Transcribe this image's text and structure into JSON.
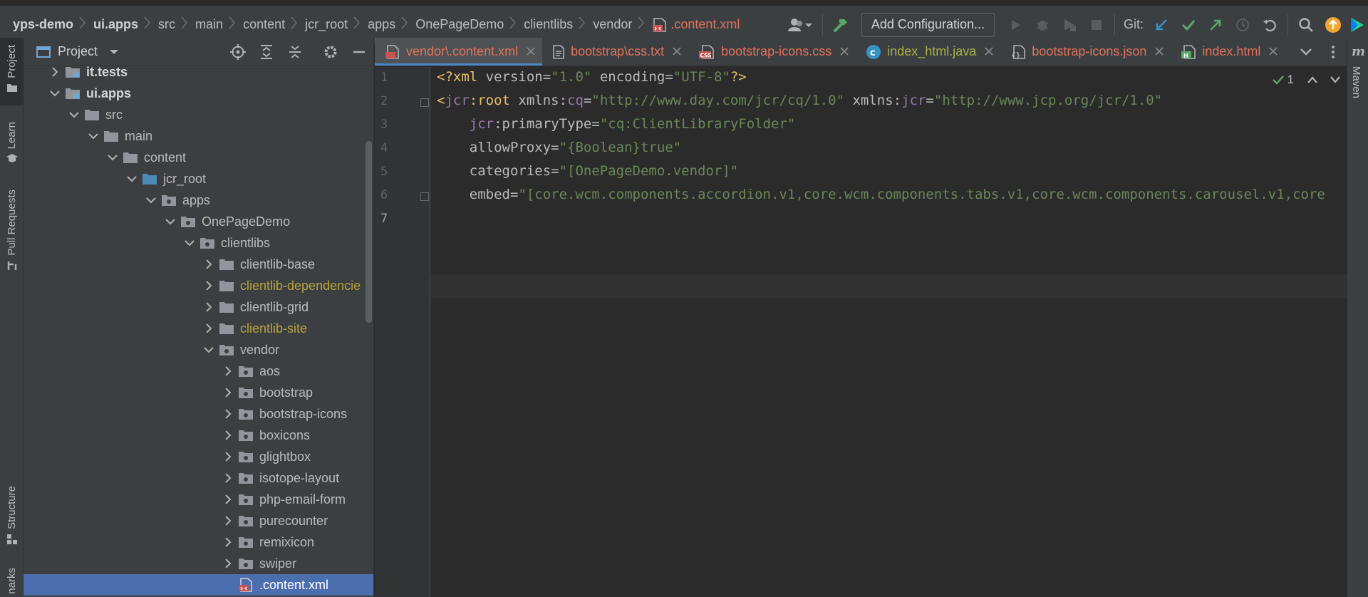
{
  "breadcrumbs": [
    {
      "label": "yps-demo",
      "bold": true
    },
    {
      "label": "ui.apps",
      "bold": true
    },
    {
      "label": "src"
    },
    {
      "label": "main"
    },
    {
      "label": "content"
    },
    {
      "label": "jcr_root"
    },
    {
      "label": "apps"
    },
    {
      "label": "OnePageDemo"
    },
    {
      "label": "clientlibs"
    },
    {
      "label": "vendor"
    },
    {
      "label": ".content.xml",
      "file": true
    }
  ],
  "toolbar": {
    "add_configuration": "Add Configuration...",
    "git_label": "Git:"
  },
  "left_strip": {
    "project": "Project",
    "learn": "Learn",
    "pull_requests": "Pull Requests",
    "structure": "Structure",
    "bookmarks": "narks"
  },
  "right_strip": {
    "maven": "Maven"
  },
  "project_panel": {
    "title": "Project"
  },
  "tree": [
    {
      "label": "it.tests",
      "depth": 0,
      "arrow": "right",
      "icon": "module",
      "bold": true
    },
    {
      "label": "ui.apps",
      "depth": 0,
      "arrow": "down",
      "icon": "module",
      "bold": true
    },
    {
      "label": "src",
      "depth": 1,
      "arrow": "down",
      "icon": "folder"
    },
    {
      "label": "main",
      "depth": 2,
      "arrow": "down",
      "icon": "folder"
    },
    {
      "label": "content",
      "depth": 3,
      "arrow": "down",
      "icon": "folder"
    },
    {
      "label": "jcr_root",
      "depth": 4,
      "arrow": "down",
      "icon": "folder-blue"
    },
    {
      "label": "apps",
      "depth": 5,
      "arrow": "down",
      "icon": "package"
    },
    {
      "label": "OnePageDemo",
      "depth": 6,
      "arrow": "down",
      "icon": "package"
    },
    {
      "label": "clientlibs",
      "depth": 7,
      "arrow": "down",
      "icon": "package"
    },
    {
      "label": "clientlib-base",
      "depth": 8,
      "arrow": "right",
      "icon": "folder"
    },
    {
      "label": "clientlib-dependencie",
      "depth": 8,
      "arrow": "right",
      "icon": "folder",
      "color": "yellow"
    },
    {
      "label": "clientlib-grid",
      "depth": 8,
      "arrow": "right",
      "icon": "folder"
    },
    {
      "label": "clientlib-site",
      "depth": 8,
      "arrow": "right",
      "icon": "folder",
      "color": "yellow"
    },
    {
      "label": "vendor",
      "depth": 8,
      "arrow": "down",
      "icon": "package"
    },
    {
      "label": "aos",
      "depth": 9,
      "arrow": "right",
      "icon": "package"
    },
    {
      "label": "bootstrap",
      "depth": 9,
      "arrow": "right",
      "icon": "package"
    },
    {
      "label": "bootstrap-icons",
      "depth": 9,
      "arrow": "right",
      "icon": "package"
    },
    {
      "label": "boxicons",
      "depth": 9,
      "arrow": "right",
      "icon": "package"
    },
    {
      "label": "glightbox",
      "depth": 9,
      "arrow": "right",
      "icon": "package"
    },
    {
      "label": "isotope-layout",
      "depth": 9,
      "arrow": "right",
      "icon": "package"
    },
    {
      "label": "php-email-form",
      "depth": 9,
      "arrow": "right",
      "icon": "package"
    },
    {
      "label": "purecounter",
      "depth": 9,
      "arrow": "right",
      "icon": "package"
    },
    {
      "label": "remixicon",
      "depth": 9,
      "arrow": "right",
      "icon": "package"
    },
    {
      "label": "swiper",
      "depth": 9,
      "arrow": "right",
      "icon": "package"
    },
    {
      "label": ".content.xml",
      "depth": 9,
      "arrow": "none",
      "icon": "xml",
      "selected": true
    }
  ],
  "tabs": [
    {
      "label": "vendor\\.content.xml",
      "icon": "xml",
      "color": "red",
      "active": true
    },
    {
      "label": "bootstrap\\css.txt",
      "icon": "txt",
      "color": "red"
    },
    {
      "label": "bootstrap-icons.css",
      "icon": "css",
      "color": "red"
    },
    {
      "label": "index_html.java",
      "icon": "java",
      "color": "olive"
    },
    {
      "label": "bootstrap-icons.json",
      "icon": "json",
      "color": "red"
    },
    {
      "label": "index.html",
      "icon": "html",
      "color": "red"
    }
  ],
  "editor": {
    "inspection_count": "1",
    "line_numbers": [
      "1",
      "2",
      "3",
      "4",
      "5",
      "6",
      "7"
    ],
    "lines": [
      [
        [
          "xml",
          "<?xml "
        ],
        [
          "attr",
          "version"
        ],
        [
          "attr",
          "="
        ],
        [
          "val",
          "\"1.0\""
        ],
        [
          "attr",
          " encoding"
        ],
        [
          "attr",
          "="
        ],
        [
          "val",
          "\"UTF-8\""
        ],
        [
          "xml",
          "?>"
        ]
      ],
      [
        [
          "xml",
          "<"
        ],
        [
          "ns",
          "jcr"
        ],
        [
          "tag",
          ":root "
        ],
        [
          "attr",
          "xmlns:"
        ],
        [
          "ns",
          "cq"
        ],
        [
          "attr",
          "="
        ],
        [
          "val",
          "\"http://www.day.com/jcr/cq/1.0\""
        ],
        [
          "attr",
          " xmlns:"
        ],
        [
          "ns",
          "jcr"
        ],
        [
          "attr",
          "="
        ],
        [
          "val",
          "\"http://www.jcp.org/jcr/1.0\""
        ]
      ],
      [
        [
          "attr",
          "    "
        ],
        [
          "ns",
          "jcr"
        ],
        [
          "attr",
          ":primaryType="
        ],
        [
          "val",
          "\"cq:ClientLibraryFolder\""
        ]
      ],
      [
        [
          "attr",
          "    allowProxy="
        ],
        [
          "val",
          "\"{Boolean}true\""
        ]
      ],
      [
        [
          "attr",
          "    categories="
        ],
        [
          "val",
          "\"[OnePageDemo.vendor]\""
        ]
      ],
      [
        [
          "attr",
          "    embed="
        ],
        [
          "val",
          "\"[core.wcm.components.accordion.v1,core.wcm.components.tabs.v1,core.wcm.components.carousel.v1,core"
        ]
      ],
      []
    ]
  }
}
